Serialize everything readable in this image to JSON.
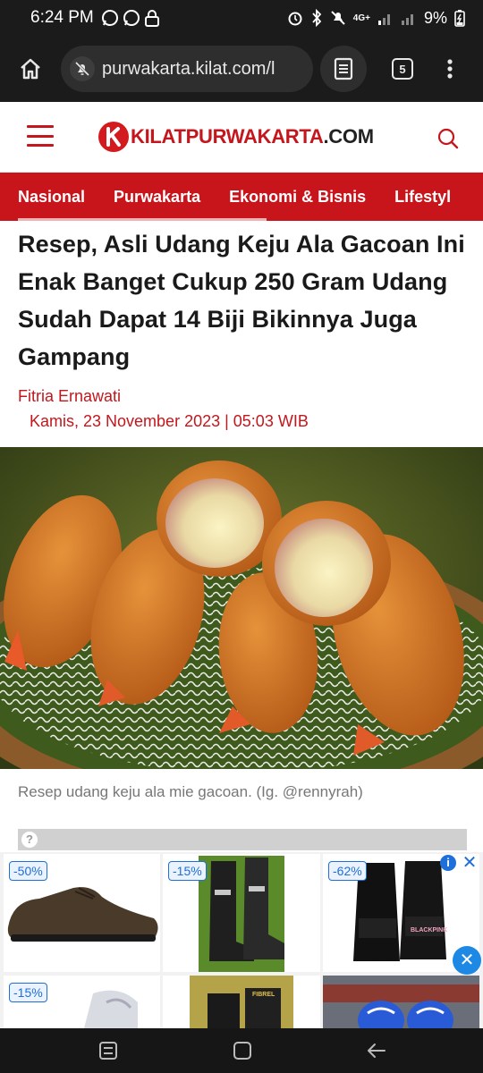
{
  "status_bar": {
    "time": "6:24 PM",
    "battery": "9%",
    "network": "4G+",
    "icons": [
      "whatsapp-icon",
      "whatsapp-icon",
      "lock-icon",
      "alarm-icon",
      "bluetooth-icon",
      "mute-icon",
      "signal-icon",
      "signal-icon",
      "battery-charging-icon"
    ]
  },
  "browser": {
    "url": "purwakarta.kilat.com/l",
    "tab_count": "5",
    "icons": {
      "home": "home-icon",
      "site": "notifications-off-icon",
      "reader": "reader-mode-icon",
      "menu": "more-vert-icon"
    }
  },
  "site": {
    "brand_prefix": "KILATPURWAKARTA",
    "brand_suffix": ".COM",
    "logo_letter": "K",
    "accent_color": "#c8141b"
  },
  "nav": {
    "items": [
      "Nasional",
      "Purwakarta",
      "Ekonomi & Bisnis",
      "Lifestyl"
    ]
  },
  "article": {
    "headline": "Resep, Asli Udang Keju Ala Gacoan Ini Enak Banget Cukup 250 Gram Udang Sudah Dapat 14 Biji Bikinnya Juga Gampang",
    "author": "Fitria Ernawati",
    "date": "Kamis, 23 November 2023 | 05:03 WIB",
    "caption": "Resep udang keju ala mie gacoan. (Ig. @rennyrah)"
  },
  "ad": {
    "info_symbol": "?",
    "items": [
      {
        "discount": "-50%",
        "product": "shoe"
      },
      {
        "discount": "-15%",
        "product": "boots"
      },
      {
        "discount": "-62%",
        "product": "slides",
        "label": "BLACKPINK"
      },
      {
        "discount": "-15%",
        "product": "shoe"
      },
      {
        "discount": "",
        "product": "sandals",
        "label": "FIBREL"
      },
      {
        "discount": "",
        "product": "helmets"
      }
    ],
    "close_symbol": "✕",
    "ad_choices_symbol": "i"
  },
  "system_nav": {
    "icons": [
      "recent-apps-icon",
      "home-icon",
      "back-icon"
    ]
  }
}
